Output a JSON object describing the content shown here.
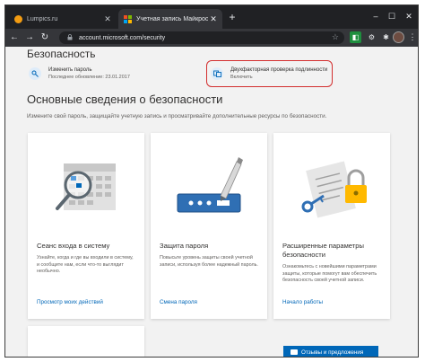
{
  "browser": {
    "tabs": [
      {
        "title": "Lumpics.ru",
        "active": false
      },
      {
        "title": "Учетная запись Майкрософт | Б",
        "active": true
      }
    ],
    "new_tab": "+",
    "url": "account.microsoft.com/security",
    "window_controls": {
      "minimize": "–",
      "maximize": "☐",
      "close": "✕"
    },
    "nav": {
      "back": "←",
      "forward": "→",
      "reload": "↻"
    },
    "colors": {
      "frame": "#202124",
      "toolbar": "#35363a"
    }
  },
  "page": {
    "section_title": "Безопасность",
    "quick_items": [
      {
        "title": "Изменить пароль",
        "subtitle": "Последнее обновление: 23.01.2017",
        "icon": "key-icon"
      },
      {
        "title": "Двухфакторная проверка подлинности",
        "subtitle": "Включить",
        "icon": "two-factor-icon",
        "highlighted": true
      }
    ],
    "main_title": "Основные сведения о безопасности",
    "main_subtitle": "Измените свой пароль, защищайте учетную запись и просматривайте дополнительные ресурсы по безопасности.",
    "cards": [
      {
        "title": "Сеанс входа в систему",
        "description": "Узнайте, когда и где вы входили в систему, и сообщите нам, если что-то выглядит необычно.",
        "link": "Просмотр моих действий",
        "icon": "activity-magnifier-icon"
      },
      {
        "title": "Защита пароля",
        "description": "Повысьте уровень защиты своей учетной записи, используя более надежный пароль.",
        "link": "Смена пароля",
        "icon": "password-pencil-icon"
      },
      {
        "title": "Расширенные параметры безопасности",
        "description": "Ознакомьтесь с новейшими параметрами защиты, которые помогут вам обеспечить безопасность своей учетной записи.",
        "link": "Начало работы",
        "icon": "padlock-keys-icon"
      }
    ],
    "feedback_button": "Отзывы и предложения",
    "colors": {
      "accent": "#0067b8",
      "highlight": "#d32f2f",
      "background": "#f2f2f2"
    }
  }
}
